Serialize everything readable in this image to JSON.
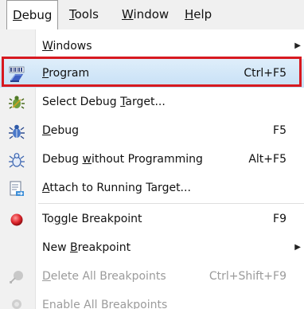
{
  "menubar": {
    "items": [
      {
        "pre": "",
        "key": "D",
        "post": "ebug"
      },
      {
        "pre": "",
        "key": "T",
        "post": "ools"
      },
      {
        "pre": "",
        "key": "W",
        "post": "indow"
      },
      {
        "pre": "",
        "key": "H",
        "post": "elp"
      }
    ]
  },
  "menu": {
    "items": [
      {
        "pre": "",
        "key": "W",
        "post": "indows",
        "shortcut": "",
        "icon": "none"
      },
      {
        "pre": "",
        "key": "P",
        "post": "rogram",
        "shortcut": "Ctrl+F5",
        "icon": "program-chip-icon"
      },
      {
        "pre": "Select Debug ",
        "key": "T",
        "post": "arget...",
        "shortcut": "",
        "icon": "debug-target-icon"
      },
      {
        "pre": "",
        "key": "D",
        "post": "ebug",
        "shortcut": "F5",
        "icon": "bug-icon"
      },
      {
        "pre": "Debug ",
        "key": "w",
        "post": "ithout Programming",
        "shortcut": "Alt+F5",
        "icon": "bug-outline-icon"
      },
      {
        "pre": "",
        "key": "A",
        "post": "ttach to Running Target...",
        "shortcut": "",
        "icon": "attach-icon"
      },
      {
        "pre": "To",
        "key": "g",
        "post": "gle Breakpoint",
        "shortcut": "F9",
        "icon": "breakpoint-icon"
      },
      {
        "pre": "New ",
        "key": "B",
        "post": "reakpoint",
        "shortcut": "",
        "icon": "none"
      },
      {
        "pre": "",
        "key": "D",
        "post": "elete All Breakpoints",
        "shortcut": "Ctrl+Shift+F9",
        "icon": "delete-breakpoints-icon"
      },
      {
        "pre": "Enable All Breakpoin",
        "key": "t",
        "post": "s",
        "shortcut": "",
        "icon": "enable-breakpoints-icon"
      }
    ]
  }
}
